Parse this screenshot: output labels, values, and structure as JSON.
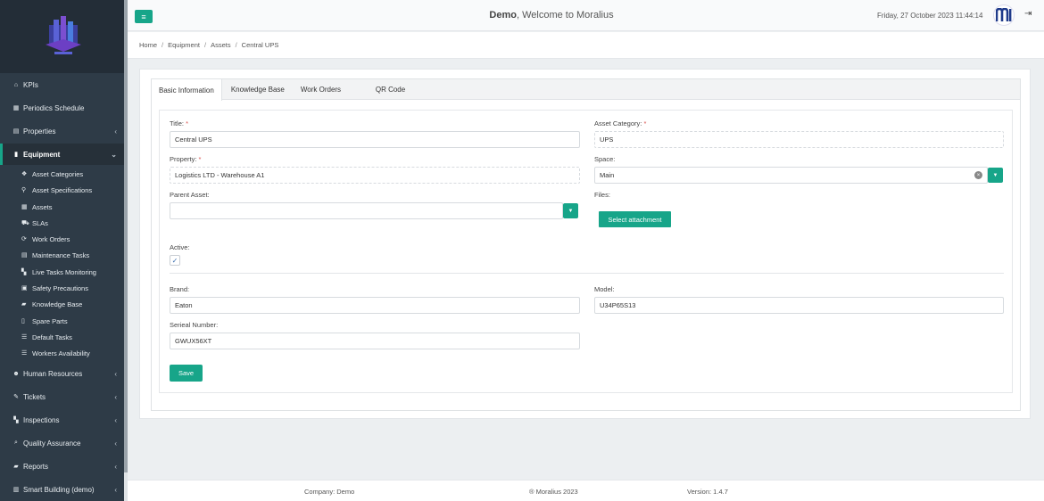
{
  "header": {
    "company_bold": "Demo",
    "welcome_text": ", Welcome to Moralius",
    "datetime": "Friday, 27 October 2023 11:44:14"
  },
  "sidebar": {
    "items": [
      {
        "label": "KPIs",
        "icon": "home-icon",
        "glyph": "⌂"
      },
      {
        "label": "Periodics Schedule",
        "icon": "calendar-icon",
        "glyph": "▦"
      },
      {
        "label": "Properties",
        "icon": "building-icon",
        "glyph": "▤",
        "chevron": "‹"
      },
      {
        "label": "Equipment",
        "icon": "equipment-icon",
        "glyph": "▮",
        "chevron": "⌄",
        "active": true
      },
      {
        "label": "Human Resources",
        "icon": "users-icon",
        "glyph": "☻",
        "chevron": "‹"
      },
      {
        "label": "Tickets",
        "icon": "ticket-icon",
        "glyph": "✎",
        "chevron": "‹"
      },
      {
        "label": "Inspections",
        "icon": "map-icon",
        "glyph": "▚",
        "chevron": "‹"
      },
      {
        "label": "Quality Assurance",
        "icon": "search-icon",
        "glyph": "⌕",
        "chevron": "‹"
      },
      {
        "label": "Reports",
        "icon": "book-icon",
        "glyph": "▰",
        "chevron": "‹"
      },
      {
        "label": "Smart Building (demo)",
        "icon": "chart-icon",
        "glyph": "▥",
        "chevron": "‹"
      }
    ],
    "sub_items": [
      {
        "label": "Asset Categories",
        "icon": "cubes-icon",
        "glyph": "❖"
      },
      {
        "label": "Asset Specifications",
        "icon": "pin-icon",
        "glyph": "⚲"
      },
      {
        "label": "Assets",
        "icon": "grid-icon",
        "glyph": "▦"
      },
      {
        "label": "SLAs",
        "icon": "truck-icon",
        "glyph": "⛟"
      },
      {
        "label": "Work Orders",
        "icon": "refresh-icon",
        "glyph": "⟳"
      },
      {
        "label": "Maintenance Tasks",
        "icon": "list-icon",
        "glyph": "▤"
      },
      {
        "label": "Live Tasks Monitoring",
        "icon": "map-icon",
        "glyph": "▚"
      },
      {
        "label": "Safety Precautions",
        "icon": "briefcase-icon",
        "glyph": "▣"
      },
      {
        "label": "Knowledge Base",
        "icon": "book-icon",
        "glyph": "▰"
      },
      {
        "label": "Spare Parts",
        "icon": "file-icon",
        "glyph": "▯"
      },
      {
        "label": "Default Tasks",
        "icon": "list-icon",
        "glyph": "☰"
      },
      {
        "label": "Workers Availability",
        "icon": "list-icon",
        "glyph": "☰"
      }
    ]
  },
  "breadcrumb": [
    "Home",
    "Equipment",
    "Assets",
    "Central UPS"
  ],
  "tabs": [
    "Basic Information",
    "Knowledge Base",
    "Work Orders",
    "QR Code"
  ],
  "form": {
    "title_label": "Title:",
    "title_value": "Central UPS",
    "asset_category_label": "Asset Category:",
    "asset_category_value": "UPS",
    "property_label": "Property:",
    "property_value": "Logistics LTD - Warehouse A1",
    "space_label": "Space:",
    "space_value": "Main",
    "parent_asset_label": "Parent Asset:",
    "parent_asset_value": "",
    "files_label": "Files:",
    "select_attachment": "Select attachment",
    "active_label": "Active:",
    "active_checked": true,
    "brand_label": "Brand:",
    "brand_value": "Eaton",
    "model_label": "Model:",
    "model_value": "U34P65S13",
    "serial_label": "Serieal Number:",
    "serial_value": "GWUX56XT",
    "required_mark": "*",
    "save_label": "Save"
  },
  "footer": {
    "company": "Company: Demo",
    "copyright": "® Moralius 2023",
    "version": "Version: 1.4.7"
  },
  "colors": {
    "accent": "#17a589",
    "sidebar_bg": "#2e3b47",
    "required": "#d9534f"
  }
}
